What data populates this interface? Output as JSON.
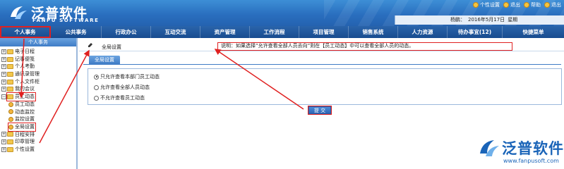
{
  "brand": {
    "name_cn": "泛普软件",
    "name_en": "FANPU SOFTWARE",
    "primary_color": "#2a6fbf",
    "highlight_color": "#e02020"
  },
  "top_links": [
    {
      "label": "个性设置",
      "icon": "user-icon"
    },
    {
      "label": "退出",
      "icon": "key-icon"
    },
    {
      "label": "帮助",
      "icon": "help-icon"
    },
    {
      "label": "退出",
      "icon": "exit-icon"
    }
  ],
  "userbar": {
    "user": "杨鹏：",
    "date": "2016年5月17日",
    "weekday": "星期"
  },
  "menu": [
    {
      "label": "个人事务",
      "active": true
    },
    {
      "label": "公共事务"
    },
    {
      "label": "行政办公"
    },
    {
      "label": "互动交流"
    },
    {
      "label": "资产管理"
    },
    {
      "label": "工作流程"
    },
    {
      "label": "项目管理"
    },
    {
      "label": "销售系统"
    },
    {
      "label": "人力资源"
    },
    {
      "label": "待办事宜(12)"
    },
    {
      "label": "快捷菜单"
    }
  ],
  "sidebar": {
    "title": "个人事务",
    "items": [
      {
        "label": "电子日程",
        "kind": "folder"
      },
      {
        "label": "记事便笺",
        "kind": "folder"
      },
      {
        "label": "个人考勤",
        "kind": "folder"
      },
      {
        "label": "通讯录管理",
        "kind": "folder"
      },
      {
        "label": "个人文件柜",
        "kind": "folder"
      },
      {
        "label": "我的会议",
        "kind": "folder"
      },
      {
        "label": "员工动态",
        "kind": "folder",
        "expanded": true
      },
      {
        "label": "员工动态",
        "kind": "child"
      },
      {
        "label": "动态监控",
        "kind": "child"
      },
      {
        "label": "监控设置",
        "kind": "child"
      },
      {
        "label": "全局设置",
        "kind": "child",
        "selected": true
      },
      {
        "label": "日程安排",
        "kind": "folder"
      },
      {
        "label": "印章管理",
        "kind": "folder"
      },
      {
        "label": "个性设置",
        "kind": "folder"
      }
    ]
  },
  "content": {
    "breadcrumb": "全局设置",
    "note": "说明：如果选择“允许查看全部人员去向”则在【员工动态】中可以查看全部人员的动态。",
    "tab": "全局设置",
    "options": [
      {
        "label": "只允许查看本部门员工动态",
        "checked": true
      },
      {
        "label": "允许查看全部人员动态",
        "checked": false
      },
      {
        "label": "不允许查看员工动态",
        "checked": false
      }
    ],
    "submit": "提 交"
  },
  "watermark": {
    "name_cn": "泛普软件",
    "url": "www.fanpusoft.com"
  }
}
